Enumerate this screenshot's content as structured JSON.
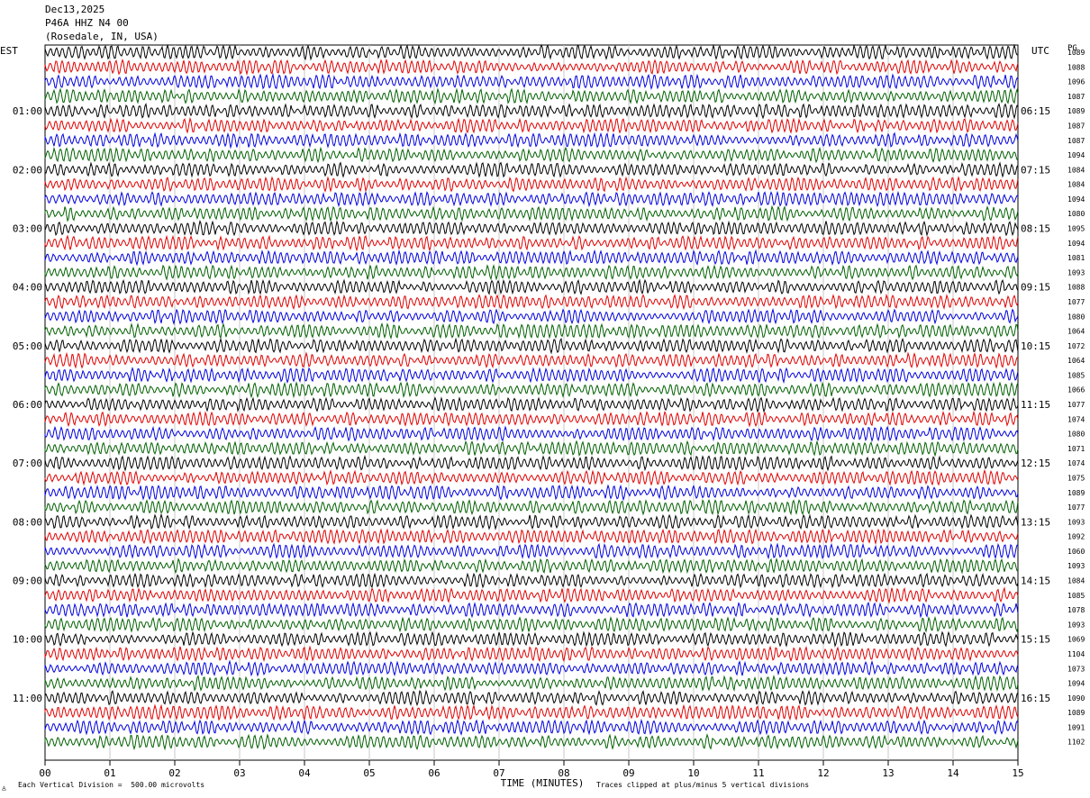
{
  "header": {
    "date": "Dec13,2025",
    "station": "P46A HHZ N4 00",
    "location": "(Rosedale, IN, USA)"
  },
  "left_label": "EST",
  "right_label": "UTC",
  "right_corner_label": "PG",
  "footer": {
    "scale_note": "Each Vertical Division =  500.00 microvolts",
    "clip_note": "Traces clipped at plus/minus 5 vertical divisions"
  },
  "chart_data": {
    "type": "line",
    "xlabel": "TIME (MINUTES)",
    "x_ticks": [
      "00",
      "01",
      "02",
      "03",
      "04",
      "05",
      "06",
      "07",
      "08",
      "09",
      "10",
      "11",
      "12",
      "13",
      "14",
      "15"
    ],
    "xlim": [
      0,
      15
    ],
    "grid": true,
    "series_colors": [
      "#000000",
      "#e00000",
      "#0000dd",
      "#006000"
    ],
    "left_time_labels": [
      "01:00",
      "02:00",
      "03:00",
      "04:00",
      "05:00",
      "06:00",
      "07:00",
      "08:00",
      "09:00",
      "10:00",
      "11:00"
    ],
    "right_time_labels": [
      "06:15",
      "07:15",
      "08:15",
      "09:15",
      "10:15",
      "11:15",
      "12:15",
      "13:15",
      "14:15",
      "15:15",
      "16:15"
    ],
    "trace_values": [
      "1089",
      "1088",
      "1096",
      "1087",
      "1089",
      "1087",
      "1087",
      "1094",
      "1084",
      "1084",
      "1094",
      "1080",
      "1095",
      "1094",
      "1081",
      "1093",
      "1088",
      "1077",
      "1080",
      "1064",
      "1072",
      "1064",
      "1085",
      "1066",
      "1077",
      "1074",
      "1080",
      "1071",
      "1074",
      "1075",
      "1089",
      "1077",
      "1093",
      "1092",
      "1060",
      "1093",
      "1084",
      "1085",
      "1078",
      "1093",
      "1069",
      "1104",
      "1073",
      "1094",
      "1090",
      "1089",
      "1091",
      "1102"
    ]
  }
}
